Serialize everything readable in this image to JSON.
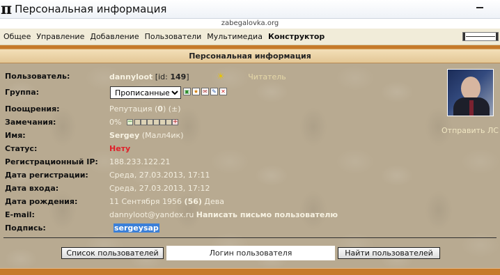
{
  "window": {
    "title": "Персональная информация",
    "app_icon": "pi-icon"
  },
  "site": {
    "domain": "zabegalovka.org"
  },
  "menu": {
    "items": [
      "Общее",
      "Управление",
      "Добавление",
      "Пользователи",
      "Мультимедиа"
    ],
    "bold_item": "Конструктор"
  },
  "header": {
    "title": "Персональная информация"
  },
  "profile": {
    "labels": {
      "user": "Пользователь:",
      "group": "Группа:",
      "rewards": "Поощрения:",
      "warnings": "Замечания:",
      "name": "Имя:",
      "status": "Статус:",
      "reg_ip": "Регистрационный IP:",
      "reg_date": "Дата регистрации:",
      "login_date": "Дата входа:",
      "birth_date": "Дата рождения:",
      "email": "E-mail:",
      "signature": "Подпись:"
    },
    "username": "dannyloot",
    "id_prefix": "[id:",
    "id": "149",
    "id_suffix": "]",
    "role": "Читатель",
    "group_value": "Прописанные",
    "reputation_label": "Репутация (",
    "reputation_value": "0",
    "reputation_suffix": ") (±)",
    "warning_percent": "0%",
    "warning_level": 0,
    "name_value": "Sergey",
    "name_nick": "(Малл4ик)",
    "status_value": "Нету",
    "reg_ip_value": "188.233.122.21",
    "reg_date_value": "Среда, 27.03.2013, 17:11",
    "login_date_value": "Среда, 27.03.2013, 17:12",
    "birth_date_value": "11 Сентября 1956",
    "age_value": "(56)",
    "zodiac": "Дева",
    "email_value": "dannyloot@yandex.ru",
    "email_link": "Написать письмо пользователю",
    "signature_value": "sergeysap",
    "send_pm": "Отправить ЛС"
  },
  "footer": {
    "users_button": "Список пользователей",
    "login_placeholder": "Логин пользователя",
    "find_button": "Найти пользователей"
  },
  "colors": {
    "accent": "#c67a2a",
    "header_bg": "#e9cfa2",
    "content_bg": "#b8aa91",
    "status_red": "#e0202a"
  }
}
